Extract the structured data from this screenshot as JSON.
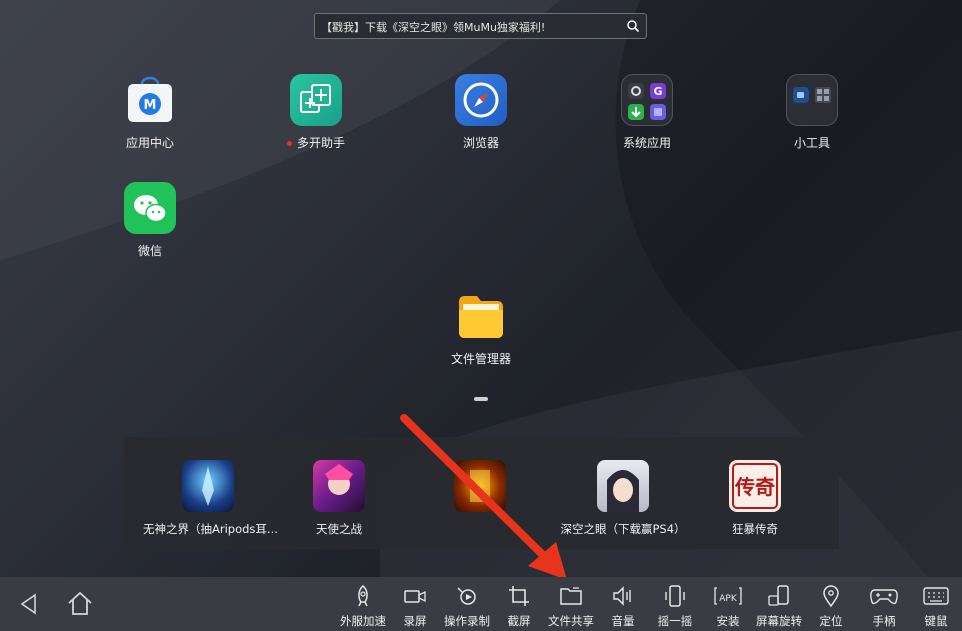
{
  "search": {
    "text": "【戳我】下载《深空之眼》领MuMu独家福利!"
  },
  "apps": [
    {
      "label": "应用中心"
    },
    {
      "label": "多开助手"
    },
    {
      "label": "浏览器"
    },
    {
      "label": "系统应用"
    },
    {
      "label": "小工具"
    },
    {
      "label": "微信"
    },
    {
      "label": "文件管理器"
    }
  ],
  "dock": [
    {
      "label": "无神之界（抽Aripods耳..."
    },
    {
      "label": "天使之战"
    },
    {
      "label": ""
    },
    {
      "label": "深空之眼（下载赢PS4）"
    },
    {
      "label": "狂暴传奇"
    }
  ],
  "game5_text": "传奇",
  "toolbar": [
    {
      "label": "外服加速"
    },
    {
      "label": "录屏"
    },
    {
      "label": "操作录制"
    },
    {
      "label": "截屏"
    },
    {
      "label": "文件共享"
    },
    {
      "label": "音量"
    },
    {
      "label": "摇一摇"
    },
    {
      "label": "安装"
    },
    {
      "label": "屏幕旋转"
    },
    {
      "label": "定位"
    },
    {
      "label": "手柄"
    },
    {
      "label": "键鼠"
    }
  ],
  "install_icon_text": "APK",
  "colors": {
    "accent_red": "#e8341c",
    "toolbar_bg": "#3a3c44"
  }
}
